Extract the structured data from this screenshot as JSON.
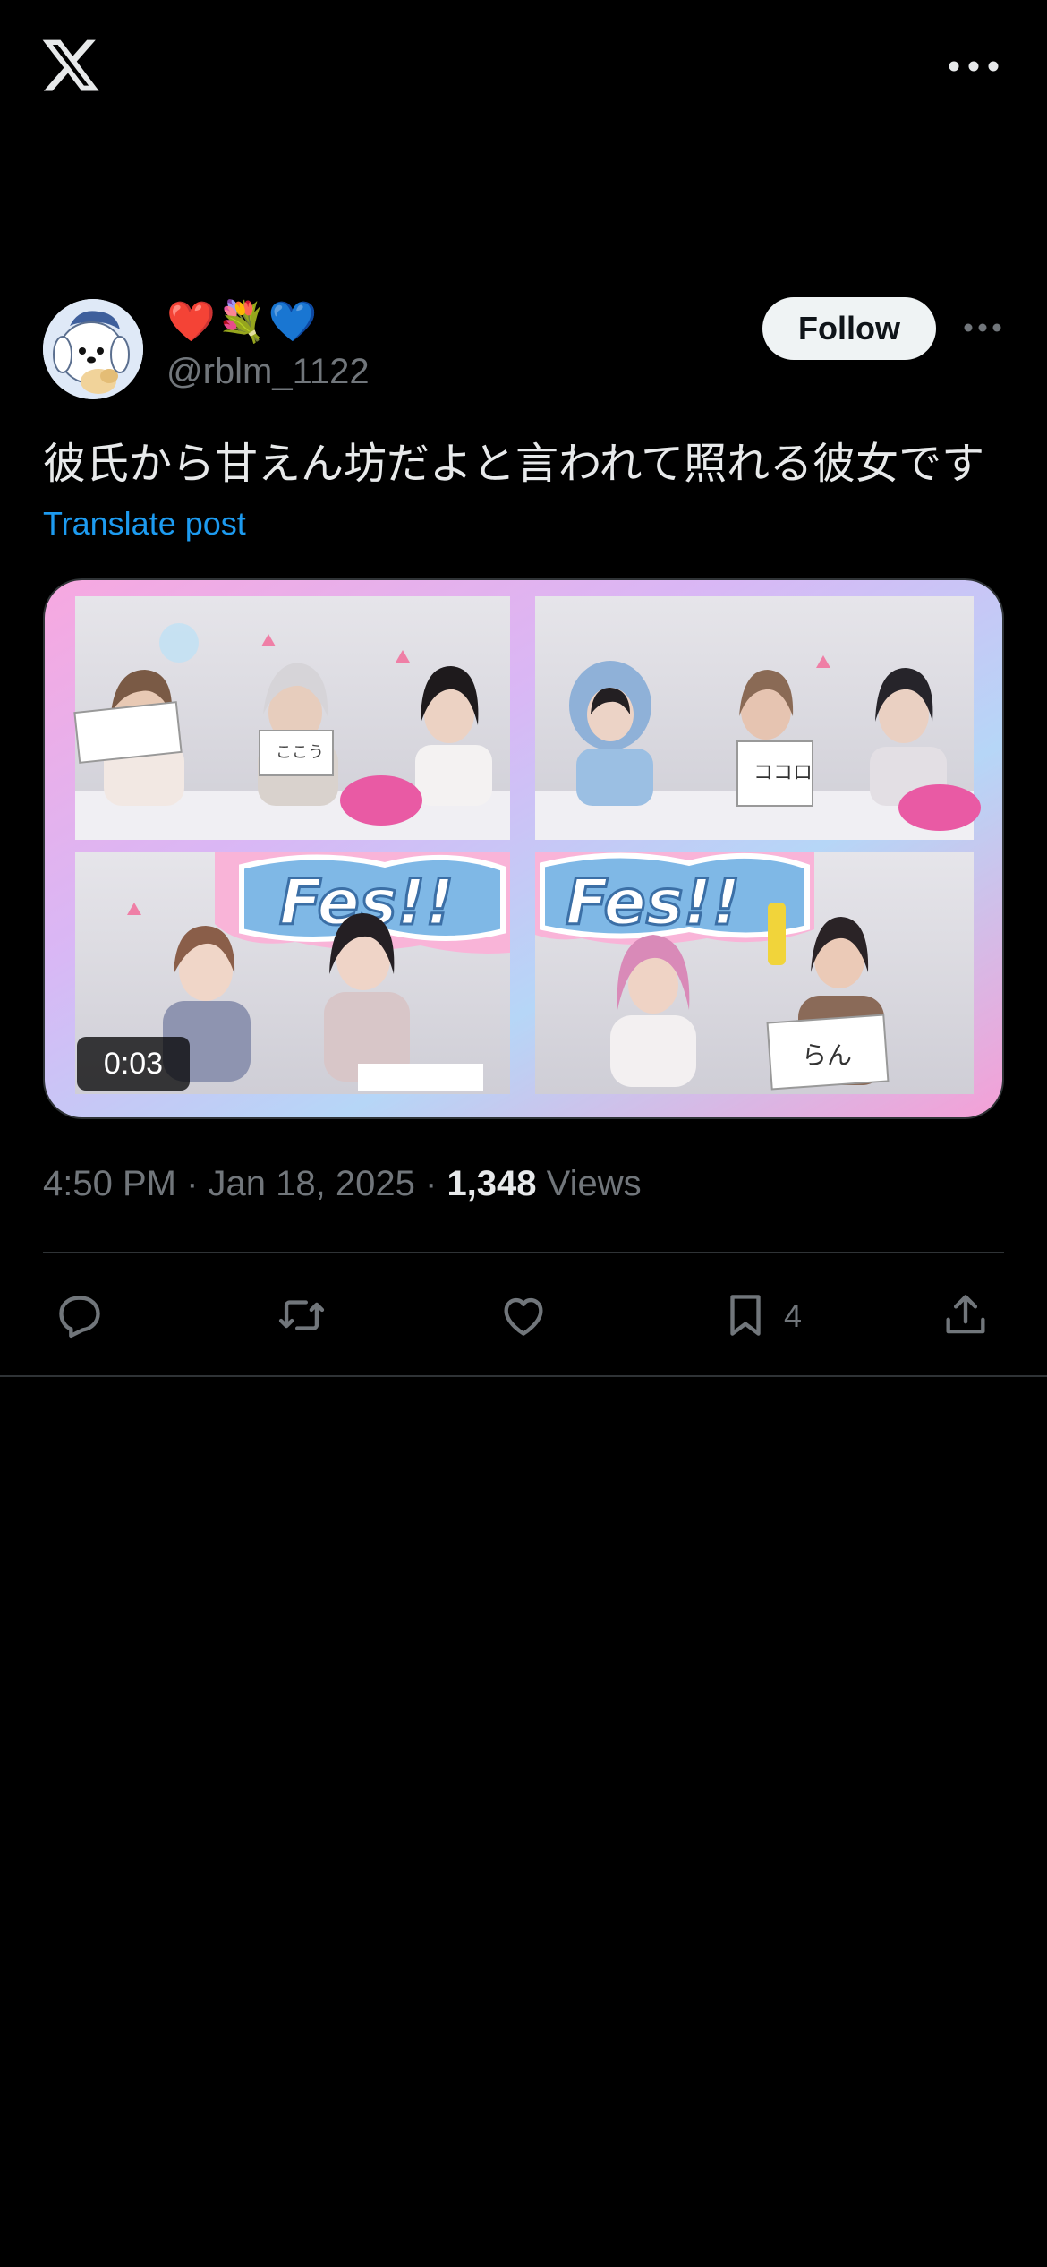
{
  "app": {
    "logo_icon": "x-logo-icon",
    "menu_icon": "more-horizontal-icon"
  },
  "post": {
    "author": {
      "display_name": "❤️💐💙",
      "handle": "@rblm_1122",
      "avatar_icon": "pochacco-avatar",
      "follow_label": "Follow"
    },
    "text": "彼氏から甘えん坊だよと言われて照れる彼女です",
    "translate_label": "Translate post",
    "media": {
      "type": "video",
      "duration": "0:03",
      "banner_text_left": "Fes!!",
      "banner_text_right": "Fes!!",
      "sign_left": "ここう",
      "sign_middle": "ココロ",
      "sign_right": "らん"
    },
    "meta": {
      "time": "4:50 PM",
      "date": "Jan 18, 2025",
      "views_count": "1,348",
      "views_label": "Views",
      "separator": "·"
    },
    "actions": {
      "reply_icon": "reply-icon",
      "repost_icon": "repost-icon",
      "like_icon": "heart-icon",
      "bookmark_icon": "bookmark-icon",
      "bookmark_count": "4",
      "share_icon": "share-icon"
    }
  },
  "colors": {
    "background": "#000000",
    "text_primary": "#e7e9ea",
    "text_secondary": "#71767b",
    "link": "#1d9bf0",
    "follow_bg": "#eff3f4",
    "divider": "#2f3336"
  }
}
